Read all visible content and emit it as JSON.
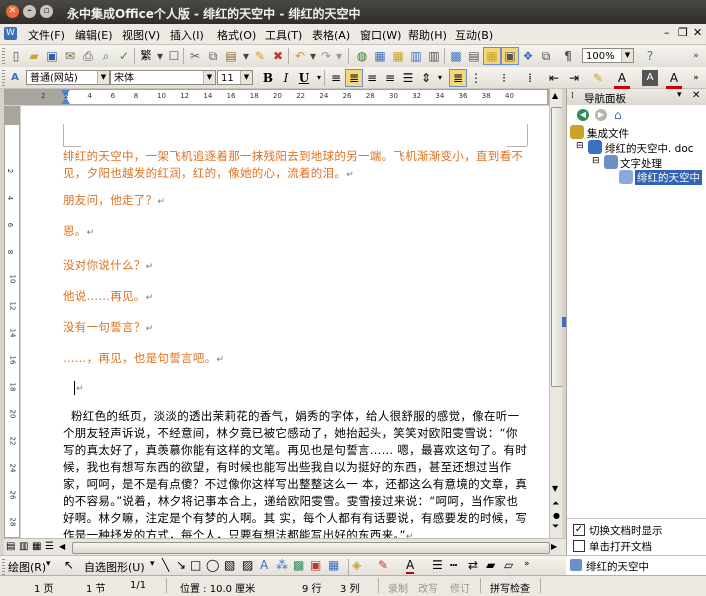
{
  "window": {
    "title": "永中集成Office个人版 - 绯红的天空中 - 绯红的天空中"
  },
  "menu": {
    "items": [
      {
        "label": "文件(F)"
      },
      {
        "label": "编辑(E)"
      },
      {
        "label": "视图(V)"
      },
      {
        "label": "插入(I)"
      },
      {
        "label": "格式(O)"
      },
      {
        "label": "工具(T)"
      },
      {
        "label": "表格(A)"
      },
      {
        "label": "窗口(W)"
      },
      {
        "label": "帮助(H)"
      },
      {
        "label": "互动(B)"
      }
    ]
  },
  "toolbar": {
    "zoom": "100%"
  },
  "format_bar": {
    "style": "普通(网站)",
    "font": "宋体",
    "size": "11",
    "bold": "B",
    "italic": "I",
    "underline": "U"
  },
  "ruler": {
    "h_ticks": [
      "2",
      "2",
      "4",
      "6",
      "8",
      "10",
      "12",
      "14",
      "16",
      "18",
      "20",
      "22",
      "24",
      "26",
      "28",
      "30",
      "32",
      "34",
      "36",
      "38",
      "40"
    ],
    "v_ticks": [
      "2",
      "4",
      "6",
      "8",
      "10",
      "12",
      "14",
      "16",
      "18",
      "20",
      "22",
      "24",
      "26",
      "28"
    ]
  },
  "document": {
    "paragraphs": [
      {
        "text": "绯红的天空中，一架飞机追逐着那一抹残阳去到地球的另一端。飞机渐渐变小，直到看不见，夕阳也越发的红润，红的，像她的心，流着的泪。",
        "color": "#e07020"
      },
      {
        "text": "朋友问，他走了？",
        "color": "#e07020"
      },
      {
        "text": "恩。",
        "color": "#e07020"
      },
      {
        "text": "没对你说什么？",
        "color": "#e07020"
      },
      {
        "text": "他说……再见。",
        "color": "#e07020"
      },
      {
        "text": "没有一句誓言？",
        "color": "#e07020"
      },
      {
        "text": "……，再见，也是句誓言吧。",
        "color": "#e07020"
      },
      {
        "text": "粉红色的纸页，淡淡的透出茉莉花的香气，娟秀的字体，给人很舒服的感觉，像在听一个朋友轻声诉说，不经意间，林夕竟已被它感动了，她抬起头，笑笑对欧阳雯雪说：“你写的真太好了，真羡慕你能有这样的文笔。再见也是句誓言…… 嗯，最喜欢这句了。有时候，我也有想写东西的欲望，有时候也能写出些我自以为挺好的东西，甚至还想过当作家，呵呵，是不是有点傻？不过像你这样写出整整这么一 本，还都这么有意境的文章，真的不容易。”说着，林夕将记事本合上，递给欧阳雯雪。雯雪接过来说：“呵呵，当作家也好啊。林夕嘛，注定是个有梦的人啊。其 实，每个人都有有话要说，有感要发的时候，写作是一种抒发的方式，每个人，只要有想法都能写出好的东西来。”",
        "color": "#000000"
      }
    ]
  },
  "nav_pane": {
    "title": "导航面板",
    "tree": [
      {
        "label": "集成文件"
      },
      {
        "label": "绯红的天空中. doc"
      },
      {
        "label": "文字处理"
      },
      {
        "label": "绯红的天空中"
      }
    ],
    "options": [
      {
        "label": "切换文档时显示",
        "checked": true
      },
      {
        "label": "单击打开文档",
        "checked": false
      }
    ]
  },
  "draw_bar": {
    "draw_label": "绘图(R)",
    "autoshape_label": "自选图形(U)"
  },
  "doc_tab": {
    "label": "绯红的天空中"
  },
  "status": {
    "page": "1 页",
    "section": "1 节",
    "page_of": "1/1",
    "position": "位置 : 10.0 厘米",
    "line": "9 行",
    "column": "3 列",
    "rec": "录制",
    "rev": "改写",
    "ext": "修订",
    "spell": "拼写检查"
  }
}
